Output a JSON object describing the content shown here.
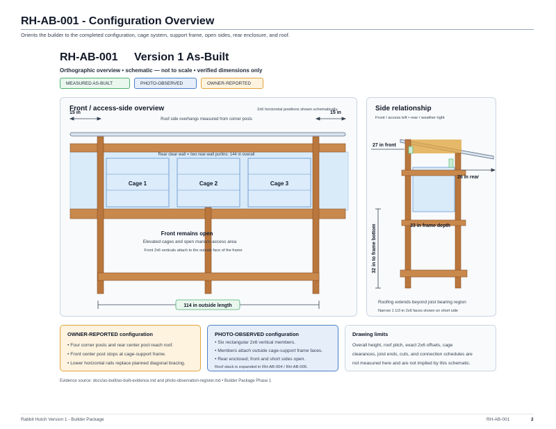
{
  "header": {
    "title": "RH-AB-001 - Configuration Overview",
    "subtitle": "Orients the builder to the completed configuration, cage system, support frame, open sides, rear enclosure, and roof."
  },
  "doc": {
    "id": "RH-AB-001",
    "version": "Version 1 As-Built",
    "subtitle": "Orthographic overview • schematic — not to scale • verified dimensions only"
  },
  "legend": [
    {
      "label": "MEASURED AS-BUILT",
      "border": "#4caf6e",
      "fill": "#e9f7ee"
    },
    {
      "label": "PHOTO-OBSERVED",
      "border": "#4a7fc9",
      "fill": "#e6eefa"
    },
    {
      "label": "OWNER-REPORTED",
      "border": "#e0a23a",
      "fill": "#fdf3df"
    }
  ],
  "front": {
    "title": "Front / access-side overview",
    "note_positions": "2x6 horizontal positions shown schematically",
    "overhang_left": "15 in",
    "overhang_right": "15 in",
    "overhang_note": "Roof side overhangs measured from corner posts",
    "rear_wall_note": "Rear clear wall = two rear-wall purlins: 144 in overall",
    "cages": [
      "Cage 1",
      "Cage 2",
      "Cage 3"
    ],
    "open_title": "Front remains open",
    "open_line1": "Elevated cages and open manure-access area",
    "open_line2": "Front 2x6 verticals attach to the outside face of the frame",
    "length_label": "114 in outside length"
  },
  "side": {
    "title": "Side relationship",
    "orientation": "Front / access left • rear / weather right",
    "front_dim": "27 in front",
    "rear_dim": "26 in rear",
    "depth_dim": "33 in frame depth",
    "height_dim": "32 in to frame bottom",
    "note1": "Roofing extends beyond joist bearing region",
    "note2": "Narrow 1 1/2-in 2x6 faces shown on short side"
  },
  "boxes": {
    "owner": {
      "title": "OWNER-REPORTED configuration",
      "items": [
        "• Four corner posts and rear center post reach roof.",
        "• Front center post stops at cage-support frame.",
        "• Lower horizontal rails replace planned diagonal bracing."
      ]
    },
    "photo": {
      "title": "PHOTO-OBSERVED configuration",
      "items": [
        "• Six rectangular 2x6 vertical members.",
        "• Members attach outside cage-support frame faces.",
        "• Rear enclosed; front and short sides open."
      ],
      "note": "Roof stack is expanded in RH-AB-004 / RH-AB-005."
    },
    "limits": {
      "title": "Drawing limits",
      "text": [
        "Overall height, roof pitch, exact 2x6 offsets, cage",
        "clearances, joist ends, cuts, and connection schedules are",
        "not measured here and are not implied by this schematic."
      ]
    }
  },
  "evidence": "Evidence source: docs/as-built/as-built-evidence.md and photo-observation-register.md • Builder Package Phase 1",
  "footer": {
    "left": "Rabbit Hutch Version 1 - Builder Package",
    "doc": "RH-AB-001",
    "page": "2"
  },
  "colors": {
    "wood": "#b9773d",
    "wood_dark": "#8a4f24",
    "board": "#c9894d",
    "glass": "#d9ebf8",
    "rule": "#94a3b8"
  }
}
